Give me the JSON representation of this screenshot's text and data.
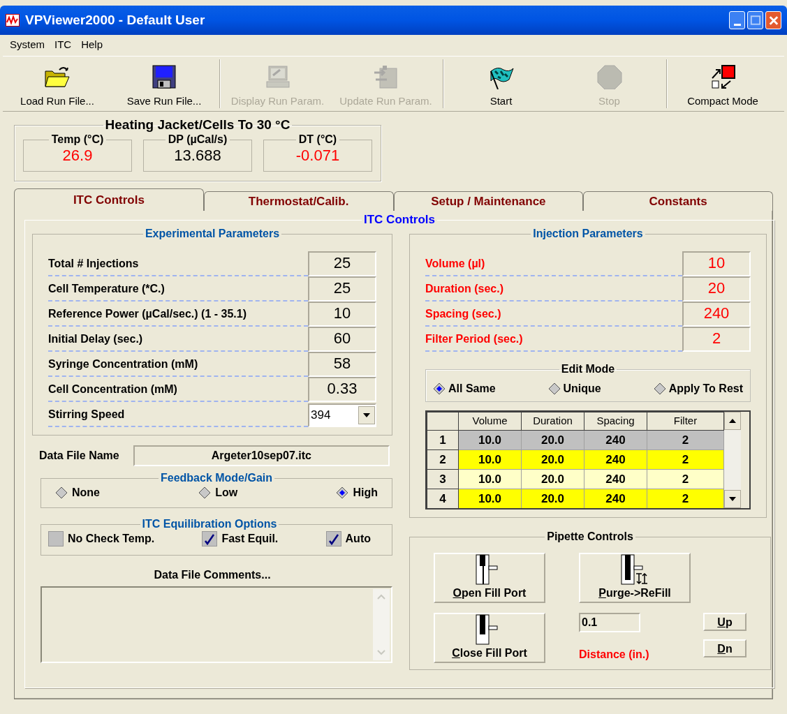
{
  "window": {
    "title": "VPViewer2000 - Default User"
  },
  "menu": [
    "System",
    "ITC",
    "Help"
  ],
  "toolbar": [
    {
      "label": "Load Run File...",
      "kind": "folder",
      "disabled": false
    },
    {
      "label": "Save Run File...",
      "kind": "disk",
      "disabled": false
    },
    {
      "label": "Display Run Param.",
      "kind": "monitor",
      "disabled": true
    },
    {
      "label": "Update Run Param.",
      "kind": "update",
      "disabled": true
    },
    {
      "label": "Start",
      "kind": "flag",
      "disabled": false
    },
    {
      "label": "Stop",
      "kind": "stop",
      "disabled": true
    },
    {
      "label": "Compact Mode",
      "kind": "compact",
      "disabled": false
    }
  ],
  "status_group": {
    "title": "Heating Jacket/Cells To 30 °C",
    "readouts": [
      {
        "label": "Temp (°C)",
        "value": "26.9",
        "color": "#ff0000"
      },
      {
        "label": "DP (µCal/s)",
        "value": "13.688",
        "color": "#000000"
      },
      {
        "label": "DT (°C)",
        "value": "-0.071",
        "color": "#ff0000"
      }
    ]
  },
  "tabs": [
    {
      "label": "ITC Controls",
      "selected": true
    },
    {
      "label": "Thermostat/Calib.",
      "selected": false
    },
    {
      "label": "Setup / Maintenance",
      "selected": false
    },
    {
      "label": "Constants",
      "selected": false
    }
  ],
  "panel_title": "ITC Controls",
  "experimental": {
    "title": "Experimental Parameters",
    "params": [
      {
        "label": "Total # Injections",
        "value": "25",
        "kind": "field"
      },
      {
        "label": "Cell Temperature (*C.)",
        "value": "25",
        "kind": "field"
      },
      {
        "label": "Reference Power (µCal/sec.) (1 - 35.1)",
        "value": "10",
        "kind": "field"
      },
      {
        "label": "Initial Delay (sec.)",
        "value": "60",
        "kind": "field"
      },
      {
        "label": "Syringe Concentration (mM)",
        "value": "58",
        "kind": "field"
      },
      {
        "label": "Cell Concentration (mM)",
        "value": "0.33",
        "kind": "field"
      },
      {
        "label": "Stirring Speed",
        "value": "394",
        "kind": "dropdown"
      }
    ]
  },
  "data_file": {
    "label": "Data File Name",
    "value": "Argeter10sep07.itc"
  },
  "feedback": {
    "title": "Feedback Mode/Gain",
    "options": [
      {
        "label": "None",
        "selected": false
      },
      {
        "label": "Low",
        "selected": false
      },
      {
        "label": "High",
        "selected": true
      }
    ]
  },
  "equilibration": {
    "title": "ITC Equilibration Options",
    "options": [
      {
        "label": "No Check Temp.",
        "checked": false
      },
      {
        "label": "Fast Equil.",
        "checked": true
      },
      {
        "label": "Auto",
        "checked": true
      }
    ]
  },
  "comments": {
    "label": "Data File Comments..."
  },
  "injection": {
    "title": "Injection Parameters",
    "params": [
      {
        "label": "Volume (µl)",
        "value": "10"
      },
      {
        "label": "Duration (sec.)",
        "value": "20"
      },
      {
        "label": "Spacing (sec.)",
        "value": "240"
      },
      {
        "label": "Filter Period (sec.)",
        "value": "2"
      }
    ]
  },
  "edit_mode": {
    "title": "Edit Mode",
    "options": [
      {
        "label": "All Same",
        "selected": true
      },
      {
        "label": "Unique",
        "selected": false
      },
      {
        "label": "Apply To Rest",
        "selected": false
      }
    ]
  },
  "grid": {
    "columns": [
      "Volume",
      "Duration",
      "Spacing",
      "Filter"
    ],
    "rows": [
      {
        "header": "1",
        "cells": [
          "10.0",
          "20.0",
          "240",
          "2"
        ],
        "selected": true
      },
      {
        "header": "2",
        "cells": [
          "10.0",
          "20.0",
          "240",
          "2"
        ],
        "selected": false
      },
      {
        "header": "3",
        "cells": [
          "10.0",
          "20.0",
          "240",
          "2"
        ],
        "selected": false
      },
      {
        "header": "4",
        "cells": [
          "10.0",
          "20.0",
          "240",
          "2"
        ],
        "selected": false
      }
    ]
  },
  "pipette": {
    "title": "Pipette Controls",
    "buttons": [
      {
        "label": "Open Fill Port",
        "kind": "open"
      },
      {
        "label": "Purge->ReFill",
        "kind": "purge"
      },
      {
        "label": "Close Fill Port",
        "kind": "close"
      }
    ],
    "distance": {
      "value": "0.1",
      "label": "Distance (in.)"
    },
    "step_buttons": [
      "Up",
      "Dn"
    ]
  }
}
